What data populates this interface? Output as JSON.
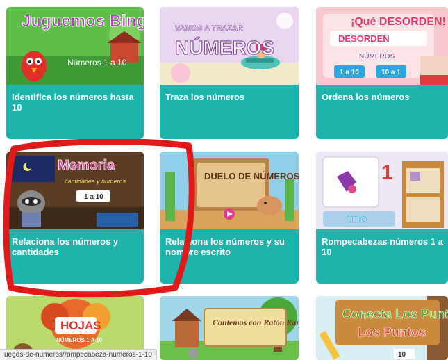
{
  "colors": {
    "card_caption_bg": "#1fb3ad",
    "caption_text": "#ffffff",
    "highlight_ring": "#e01a1a"
  },
  "cards": [
    {
      "title": "Identifica los números hasta 10",
      "thumb_title": "Juguemos Bingo",
      "thumb_subtitle": "Números 1 a 10"
    },
    {
      "title": "Traza los números",
      "thumb_title": "VAMOS A TRAZAR",
      "thumb_subtitle": "NÚMEROS"
    },
    {
      "title": "Ordena los números",
      "thumb_title": "¡Qué DESORDEN!",
      "thumb_subtitle": "NÚMEROS",
      "thumb_btn1": "1 a 10",
      "thumb_btn2": "10 a 1"
    },
    {
      "title": "Relaciona los números y cantidades",
      "thumb_title": "Memoria",
      "thumb_subtitle": "cantidades y números",
      "thumb_badge": "1 a 10"
    },
    {
      "title": "Relaciona los números y su nombre escrito",
      "thumb_title": "DUELO DE NÚMEROS"
    },
    {
      "title": "Rompecabezas números 1 a 10",
      "thumb_word": "uno",
      "thumb_num": "1"
    },
    {
      "thumb_title": "HOJAS",
      "thumb_subtitle": "NÚMEROS 1 A 10"
    },
    {
      "thumb_title": "Contemos con Ratón Ramón"
    },
    {
      "thumb_title": "Conecta Los Puntos",
      "thumb_num": "10"
    }
  ],
  "status_url": "uegos-de-numeros/rompecabeza-numeros-1-10"
}
